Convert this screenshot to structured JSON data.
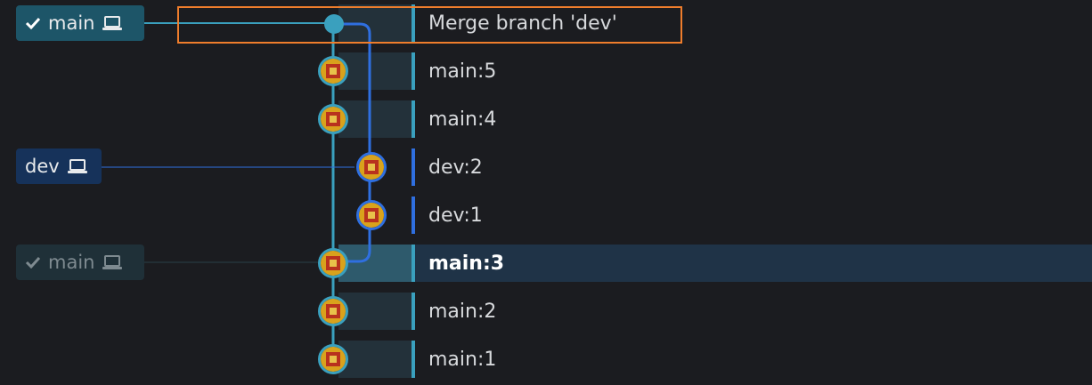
{
  "branch_tags": {
    "main": {
      "label": "main",
      "icons": [
        "check-icon",
        "laptop-icon"
      ]
    },
    "dev": {
      "label": "dev",
      "icons": [
        "laptop-icon"
      ]
    },
    "main_previous": {
      "label": "main",
      "icons": [
        "check-icon",
        "laptop-icon"
      ]
    }
  },
  "commits": [
    {
      "message": "Merge branch 'dev'",
      "branch": "main"
    },
    {
      "message": "main:5",
      "branch": "main"
    },
    {
      "message": "main:4",
      "branch": "main"
    },
    {
      "message": "dev:2",
      "branch": "dev"
    },
    {
      "message": "dev:1",
      "branch": "dev"
    },
    {
      "message": "main:3",
      "branch": "main",
      "selected": true
    },
    {
      "message": "main:2",
      "branch": "main"
    },
    {
      "message": "main:1",
      "branch": "main"
    }
  ],
  "colors": {
    "main_lane": "#3aa0be",
    "dev_lane": "#2f6fe0",
    "highlight": "#ef7d2c",
    "background": "#1b1c20"
  }
}
